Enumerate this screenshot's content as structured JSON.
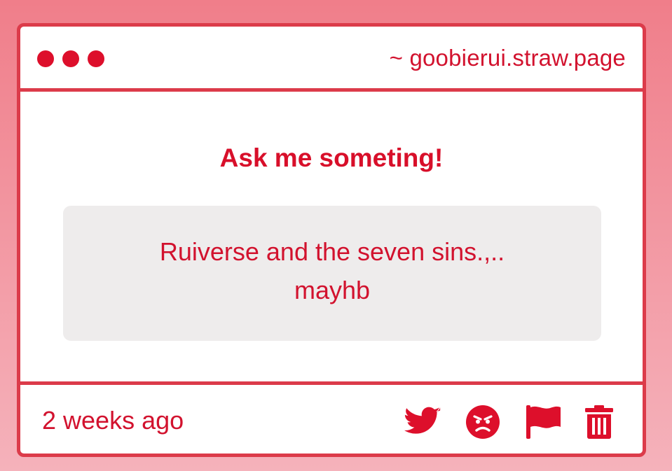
{
  "header": {
    "url": "~ goobierui.straw.page",
    "window_dots": [
      "dot",
      "dot",
      "dot"
    ]
  },
  "main": {
    "title": "Ask me someting!",
    "message_lines": [
      "Ruiverse and the seven sins.,..",
      "mayhb"
    ]
  },
  "footer": {
    "timestamp": "2 weeks ago",
    "actions": [
      {
        "icon": "twitter-icon"
      },
      {
        "icon": "angry-face-icon"
      },
      {
        "icon": "flag-icon"
      },
      {
        "icon": "trash-icon"
      }
    ]
  },
  "colors": {
    "accent": "#dd0f2b",
    "border": "#dc3b4a",
    "message_bg": "#eeecec",
    "page_bg_top": "#f07e8a",
    "page_bg_bottom": "#f5b2bb"
  }
}
